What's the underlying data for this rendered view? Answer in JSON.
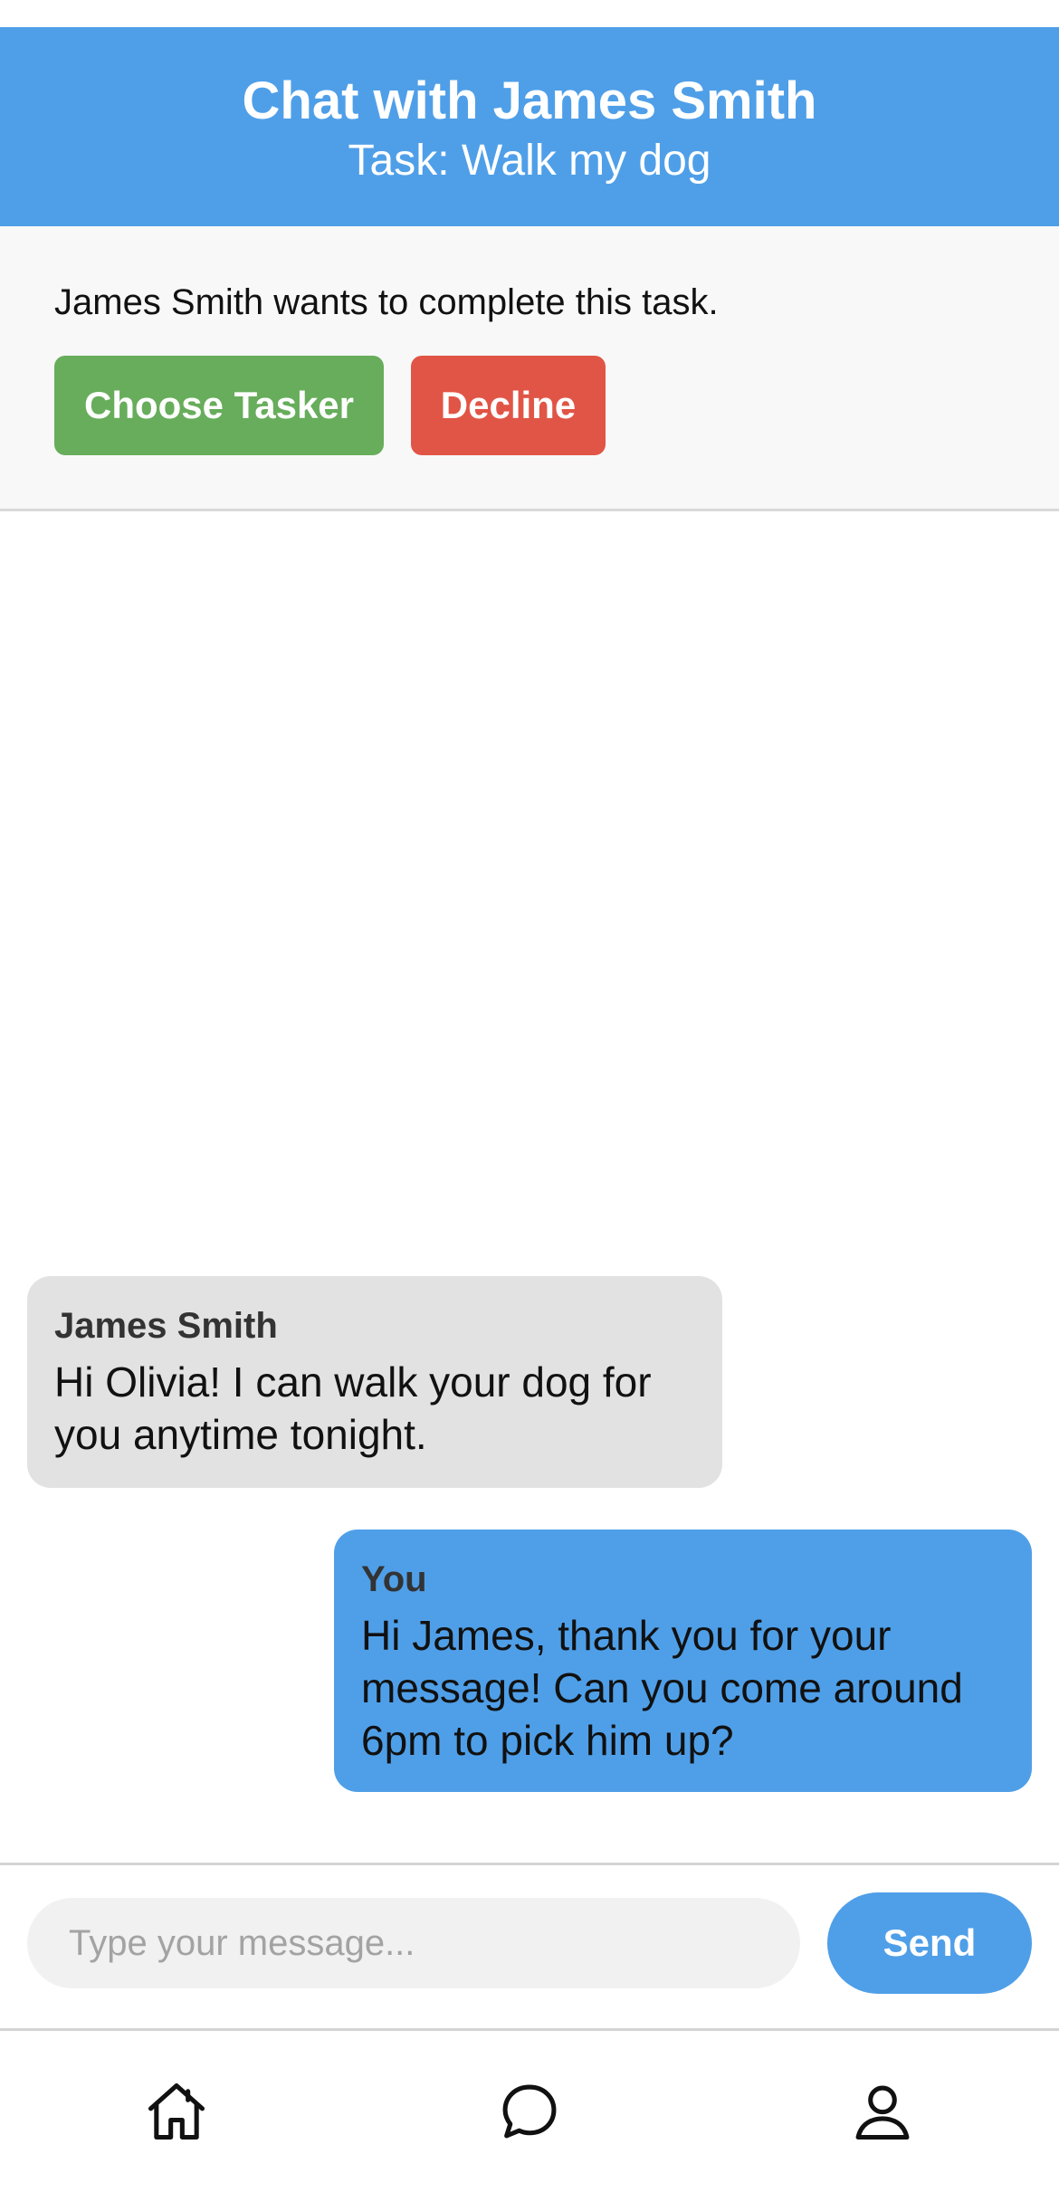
{
  "header": {
    "title": "Chat with James Smith",
    "subtitle": "Task: Walk my dog"
  },
  "offer": {
    "text": "James Smith wants to complete this task.",
    "choose_label": "Choose Tasker",
    "decline_label": "Decline"
  },
  "messages": [
    {
      "sender": "James Smith",
      "text": "Hi Olivia! I can walk your dog for you anytime tonight.",
      "direction": "incoming"
    },
    {
      "sender": "You",
      "text": "Hi James, thank you for your message! Can you come around 6pm to pick him up?",
      "direction": "outgoing"
    }
  ],
  "composer": {
    "placeholder": "Type your message...",
    "value": "",
    "send_label": "Send"
  },
  "tabbar": {
    "items": [
      {
        "icon": "home-icon"
      },
      {
        "icon": "chat-icon"
      },
      {
        "icon": "profile-icon"
      }
    ]
  },
  "colors": {
    "primary": "#4f9fe8",
    "accept": "#67ad5b",
    "decline": "#e15546",
    "incoming_bubble": "#e2e2e2"
  }
}
